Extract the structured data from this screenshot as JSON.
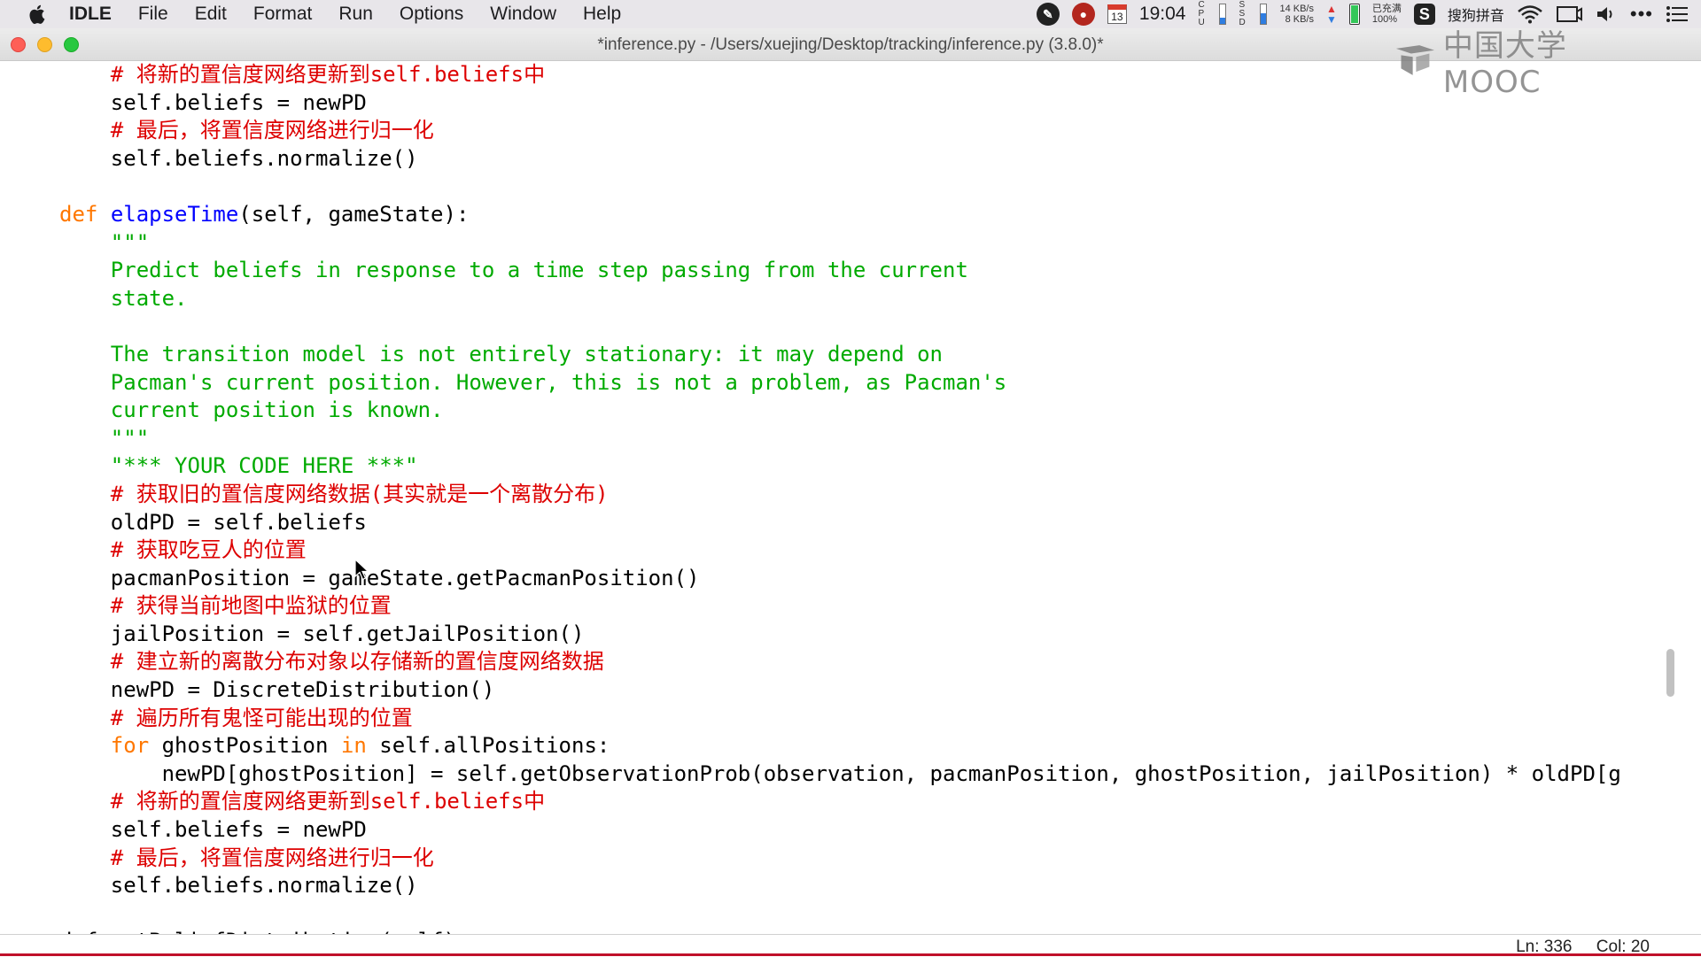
{
  "menubar": {
    "items": [
      "IDLE",
      "File",
      "Edit",
      "Format",
      "Run",
      "Options",
      "Window",
      "Help"
    ],
    "status": {
      "calendar_day": "13",
      "time": "19:04",
      "cpu_label": "C P U",
      "ssd_label": "S S D",
      "net_up": "14 KB/s",
      "net_down": "8 KB/s",
      "battery_state": "已充满",
      "battery_percent": "100%",
      "ime_name": "搜狗拼音",
      "ime_icon": "S",
      "more": "•••"
    }
  },
  "window": {
    "title": "*inference.py - /Users/xuejing/Desktop/tracking/inference.py (3.8.0)*"
  },
  "watermark": {
    "text": "中国大学MOOC"
  },
  "editor": {
    "lines": [
      [
        {
          "t": "    "
        },
        {
          "t": "# 将新的置信度网络更新到self.beliefs中",
          "c": "comment"
        }
      ],
      [
        {
          "t": "    self.beliefs = newPD"
        }
      ],
      [
        {
          "t": "    "
        },
        {
          "t": "# 最后，将置信度网络进行归一化",
          "c": "comment"
        }
      ],
      [
        {
          "t": "    self.beliefs.normalize()"
        }
      ],
      [
        {
          "t": ""
        }
      ],
      [
        {
          "t": "def",
          "c": "keyword"
        },
        {
          "t": " "
        },
        {
          "t": "elapseTime",
          "c": "def"
        },
        {
          "t": "(self, gameState):"
        }
      ],
      [
        {
          "t": "    "
        },
        {
          "t": "\"\"\"",
          "c": "string"
        }
      ],
      [
        {
          "t": "    "
        },
        {
          "t": "Predict beliefs in response to a time step passing from the current",
          "c": "string"
        }
      ],
      [
        {
          "t": "    "
        },
        {
          "t": "state.",
          "c": "string"
        }
      ],
      [
        {
          "t": ""
        }
      ],
      [
        {
          "t": "    "
        },
        {
          "t": "The transition model is not entirely stationary: it may depend on",
          "c": "string"
        }
      ],
      [
        {
          "t": "    "
        },
        {
          "t": "Pacman's current position. However, this is not a problem, as Pacman's",
          "c": "string"
        }
      ],
      [
        {
          "t": "    "
        },
        {
          "t": "current position is known.",
          "c": "string"
        }
      ],
      [
        {
          "t": "    "
        },
        {
          "t": "\"\"\"",
          "c": "string"
        }
      ],
      [
        {
          "t": "    "
        },
        {
          "t": "\"*** YOUR CODE HERE ***\"",
          "c": "string"
        }
      ],
      [
        {
          "t": "    "
        },
        {
          "t": "# 获取旧的置信度网络数据(其实就是一个离散分布)",
          "c": "comment"
        }
      ],
      [
        {
          "t": "    oldPD = self.beliefs"
        }
      ],
      [
        {
          "t": "    "
        },
        {
          "t": "# 获取吃豆人的位置",
          "c": "comment"
        }
      ],
      [
        {
          "t": "    pacmanPosition = gameState.getPacmanPosition()"
        }
      ],
      [
        {
          "t": "    "
        },
        {
          "t": "# 获得当前地图中监狱的位置",
          "c": "comment"
        }
      ],
      [
        {
          "t": "    jailPosition = self.getJailPosition()"
        }
      ],
      [
        {
          "t": "    "
        },
        {
          "t": "# 建立新的离散分布对象以存储新的置信度网络数据",
          "c": "comment"
        }
      ],
      [
        {
          "t": "    newPD = DiscreteDistribution()"
        }
      ],
      [
        {
          "t": "    "
        },
        {
          "t": "# 遍历所有鬼怪可能出现的位置",
          "c": "comment"
        }
      ],
      [
        {
          "t": "    "
        },
        {
          "t": "for",
          "c": "keyword"
        },
        {
          "t": " ghostPosition "
        },
        {
          "t": "in",
          "c": "keyword"
        },
        {
          "t": " self.allPositions:"
        }
      ],
      [
        {
          "t": "        newPD[ghostPosition] = self.getObservationProb(observation, pacmanPosition, ghostPosition, jailPosition) * oldPD[g"
        }
      ],
      [
        {
          "t": "    "
        },
        {
          "t": "# 将新的置信度网络更新到self.beliefs中",
          "c": "comment"
        }
      ],
      [
        {
          "t": "    self.beliefs = newPD"
        }
      ],
      [
        {
          "t": "    "
        },
        {
          "t": "# 最后，将置信度网络进行归一化",
          "c": "comment"
        }
      ],
      [
        {
          "t": "    self.beliefs.normalize()"
        }
      ],
      [
        {
          "t": ""
        }
      ],
      [
        {
          "t": "def getBeliefDistribution(self):"
        }
      ]
    ]
  },
  "statusbar": {
    "line": "Ln: 336",
    "col": "Col: 20"
  },
  "colors": {
    "comment": "#dd0000",
    "string": "#00aa00",
    "keyword": "#ff7700",
    "definition": "#0000ff",
    "accent_line": "#c0102a"
  },
  "icons": [
    "apple-icon",
    "app-status-icon",
    "calendar-icon",
    "cpu-indicator-icon",
    "battery-icon",
    "sogou-icon",
    "wifi-icon",
    "screen-mirror-icon",
    "volume-icon",
    "more-icon",
    "list-icon",
    "mooc-logo-icon",
    "mouse-pointer-icon"
  ]
}
